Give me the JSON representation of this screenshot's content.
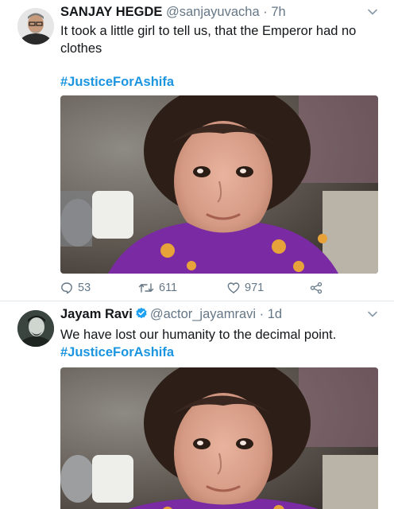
{
  "tweets": [
    {
      "author_name": "SANJAY HEGDE",
      "handle": "@sanjayuvacha",
      "separator": " · ",
      "time": "7h",
      "text": "It took a little girl to tell us, that the Emperor had no clothes",
      "hashtag": "#JusticeForAshifa",
      "replies": "53",
      "retweets": "611",
      "likes": "971",
      "verified": false
    },
    {
      "author_name": "Jayam Ravi",
      "handle": "@actor_jayamravi",
      "separator": " · ",
      "time": "1d",
      "text": "We have lost our humanity to the decimal point.",
      "hashtag": "#JusticeForAshifa",
      "verified": true
    }
  ],
  "colors": {
    "hashtag": "#1b95e0",
    "verified": "#1da1f2",
    "muted": "#657786",
    "divider": "#e1e8ed"
  },
  "icons": {
    "reply": "speech-bubble-icon",
    "retweet": "retweet-arrows-icon",
    "like": "heart-icon",
    "share": "share-nodes-icon",
    "more": "chevron-down-icon"
  }
}
